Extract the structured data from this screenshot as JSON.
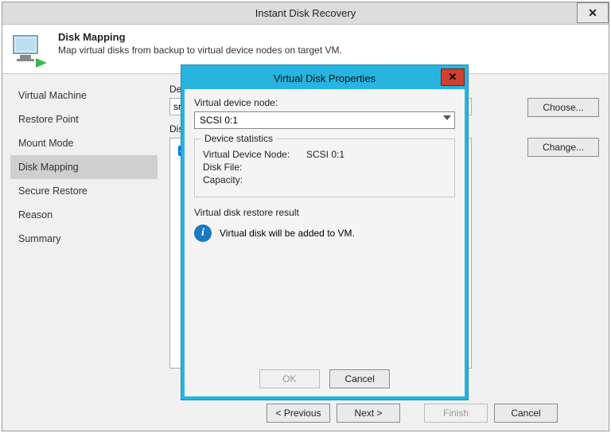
{
  "window": {
    "title": "Instant Disk Recovery",
    "close_glyph": "✕"
  },
  "header": {
    "title": "Disk Mapping",
    "subtitle": "Map virtual disks from backup to virtual device nodes on target VM."
  },
  "sidebar": {
    "items": [
      {
        "label": "Virtual Machine"
      },
      {
        "label": "Restore Point"
      },
      {
        "label": "Mount Mode"
      },
      {
        "label": "Disk Mapping"
      },
      {
        "label": "Secure Restore"
      },
      {
        "label": "Reason"
      },
      {
        "label": "Summary"
      }
    ],
    "active": 3
  },
  "main": {
    "dest_label": "Des",
    "dest_value": "srv",
    "choose": "Choose...",
    "disks_label": "Disk",
    "change": "Change..."
  },
  "footer": {
    "previous": "< Previous",
    "next": "Next >",
    "finish": "Finish",
    "cancel": "Cancel"
  },
  "modal": {
    "title": "Virtual Disk Properties",
    "close_glyph": "✕",
    "node_label": "Virtual device node:",
    "node_value": "SCSI 0:1",
    "stats_legend": "Device statistics",
    "stats": {
      "vd_node_k": "Virtual Device Node:",
      "vd_node_v": "SCSI 0:1",
      "disk_file_k": "Disk File:",
      "disk_file_v": "",
      "capacity_k": "Capacity:",
      "capacity_v": ""
    },
    "restore_label": "Virtual disk restore result",
    "restore_msg": "Virtual disk will be added to VM.",
    "ok": "OK",
    "cancel": "Cancel"
  }
}
